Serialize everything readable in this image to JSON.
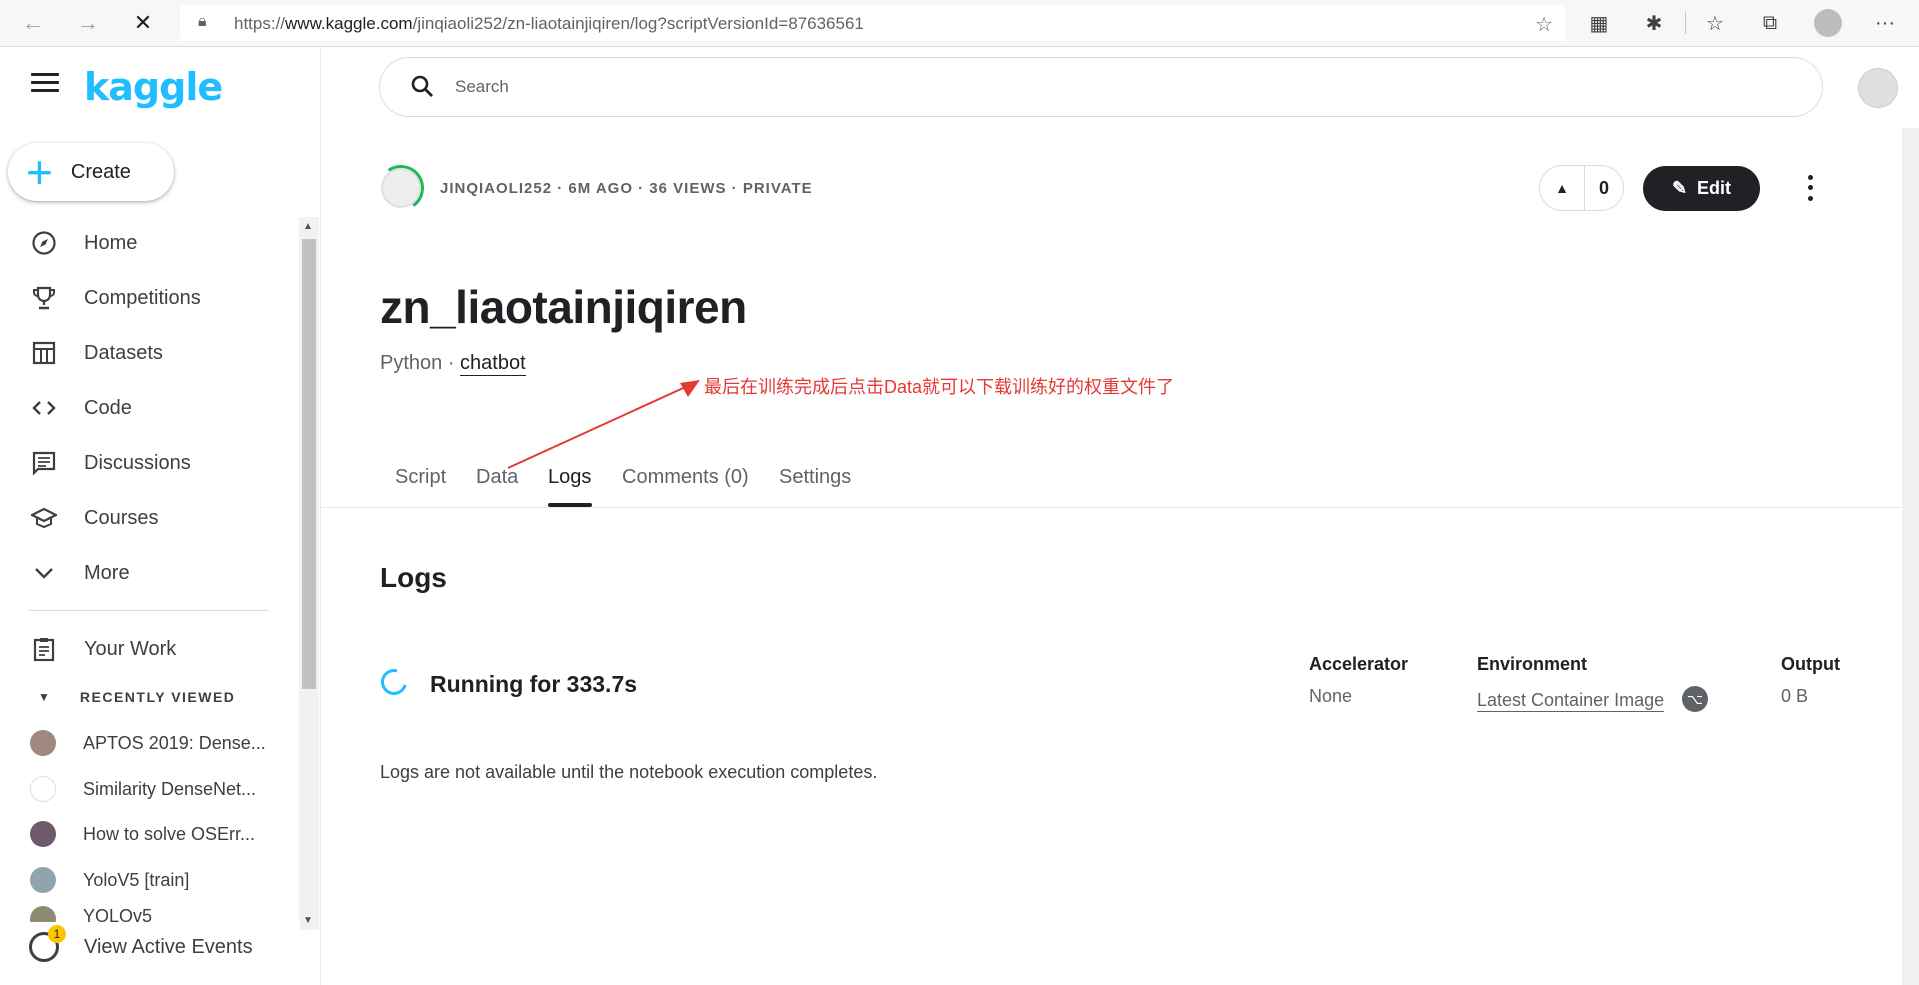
{
  "browser": {
    "url_prefix": "https://",
    "url_host": "www.kaggle.com",
    "url_path": "/jinqiaoli252/zn-liaotainjiqiren/log?scriptVersionId=87636561"
  },
  "sidebar": {
    "logo": "kaggle",
    "create_label": "Create",
    "items": [
      {
        "label": "Home",
        "icon": "compass-icon"
      },
      {
        "label": "Competitions",
        "icon": "trophy-icon"
      },
      {
        "label": "Datasets",
        "icon": "table-icon"
      },
      {
        "label": "Code",
        "icon": "code-icon"
      },
      {
        "label": "Discussions",
        "icon": "comment-icon"
      },
      {
        "label": "Courses",
        "icon": "school-icon"
      },
      {
        "label": "More",
        "icon": "chevron-down-icon"
      }
    ],
    "your_work": "Your Work",
    "recently_viewed_label": "RECENTLY VIEWED",
    "recent": [
      "APTOS 2019: Dense...",
      "Similarity DenseNet...",
      "How to solve OSErr...",
      "YoloV5 [train]",
      "YOLOv5"
    ],
    "events_label": "View Active Events",
    "events_badge": "1"
  },
  "header": {
    "search_placeholder": "Search"
  },
  "notebook": {
    "meta": "JINQIAOLI252 · 6M AGO · 36 VIEWS · PRIVATE",
    "vote_count": "0",
    "edit_label": "Edit",
    "title": "zn_liaotainjiqiren",
    "language": "Python · ",
    "tag": "chatbot",
    "annotation": "最后在训练完成后点击Data就可以下载训练好的权重文件了",
    "tabs": [
      "Script",
      "Data",
      "Logs",
      "Comments (0)",
      "Settings"
    ]
  },
  "logs": {
    "title": "Logs",
    "status": "Running for 333.7s",
    "accelerator_label": "Accelerator",
    "accelerator_value": "None",
    "environment_label": "Environment",
    "environment_value": "Latest Container Image",
    "output_label": "Output",
    "output_value": "0 B",
    "message": "Logs are not available until the notebook execution completes."
  },
  "colors": {
    "brand": "#20beff",
    "annotation": "#e53935"
  }
}
